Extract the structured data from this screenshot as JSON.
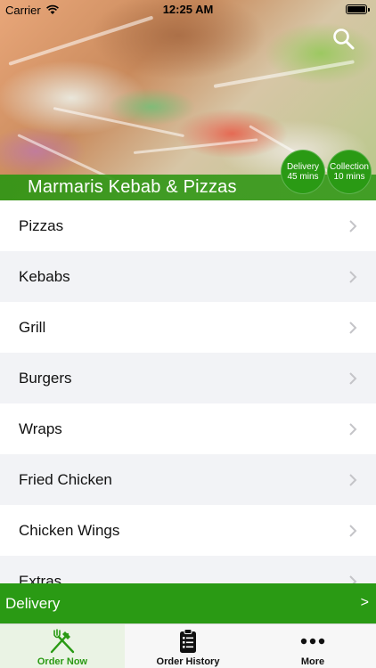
{
  "status_bar": {
    "carrier": "Carrier",
    "time": "12:25 AM"
  },
  "hero": {
    "restaurant_name": "Marmaris Kebab & Pizzas",
    "delivery": {
      "label": "Delivery",
      "time": "45 mins"
    },
    "collection": {
      "label": "Collection",
      "time": "10 mins"
    },
    "search_icon": "search-icon"
  },
  "menu": {
    "categories": [
      {
        "label": "Pizzas"
      },
      {
        "label": "Kebabs"
      },
      {
        "label": "Grill"
      },
      {
        "label": "Burgers"
      },
      {
        "label": "Wraps"
      },
      {
        "label": "Fried Chicken"
      },
      {
        "label": "Chicken Wings"
      },
      {
        "label": "Extras"
      }
    ]
  },
  "delivery_bar": {
    "label": "Delivery",
    "arrow": ">"
  },
  "tabs": [
    {
      "label": "Order Now",
      "icon": "fork-knife-icon",
      "active": true
    },
    {
      "label": "Order History",
      "icon": "clipboard-list-icon",
      "active": false
    },
    {
      "label": "More",
      "icon": "more-dots-icon",
      "active": false
    }
  ],
  "colors": {
    "brand_green": "#2a9a14",
    "row_alt": "#f2f3f6",
    "tabbar_bg": "#f7f7f7"
  }
}
